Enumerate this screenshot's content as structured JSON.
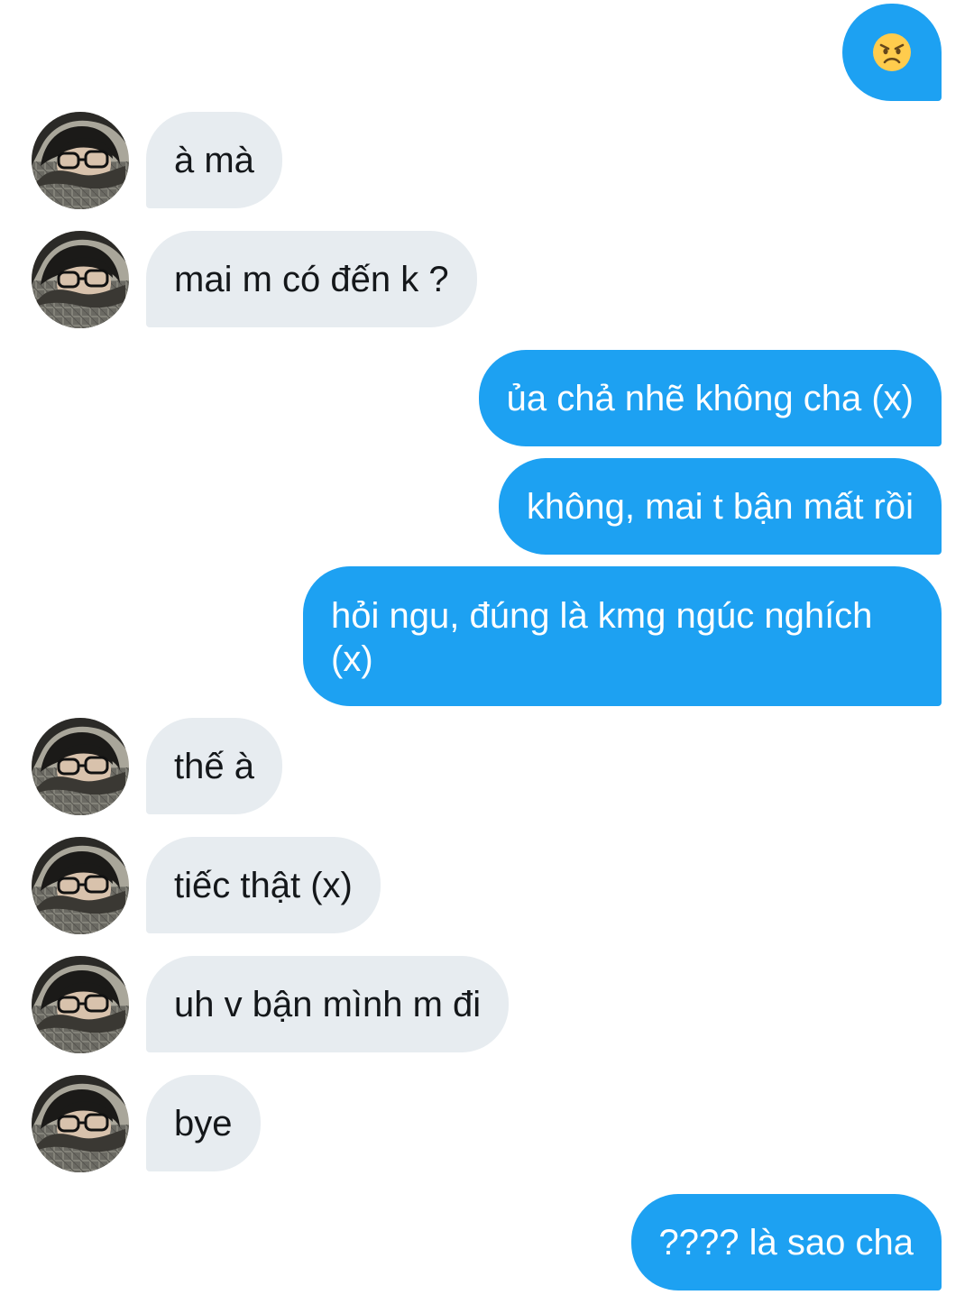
{
  "conversation": {
    "sent_emoji": {
      "icon": "angry-face-emoji"
    },
    "messages": [
      {
        "direction": "incoming",
        "text": "à mà"
      },
      {
        "direction": "incoming",
        "text": "mai m có đến k ?"
      },
      {
        "direction": "outgoing",
        "text": "ủa chả nhẽ không cha (x)"
      },
      {
        "direction": "outgoing",
        "text": "không, mai t bận mất rồi"
      },
      {
        "direction": "outgoing",
        "text": "hỏi ngu, đúng là kmg ngúc nghích (x)"
      },
      {
        "direction": "incoming",
        "text": "thế à"
      },
      {
        "direction": "incoming",
        "text": "tiếc thật (x)"
      },
      {
        "direction": "incoming",
        "text": "uh v bận mình m đi"
      },
      {
        "direction": "incoming",
        "text": "bye"
      },
      {
        "direction": "outgoing",
        "text": "???? là sao cha"
      }
    ]
  },
  "colors": {
    "outgoing_bubble": "#1da1f2",
    "incoming_bubble": "#e7ecf0",
    "incoming_text": "#14171a",
    "outgoing_text": "#ffffff"
  }
}
